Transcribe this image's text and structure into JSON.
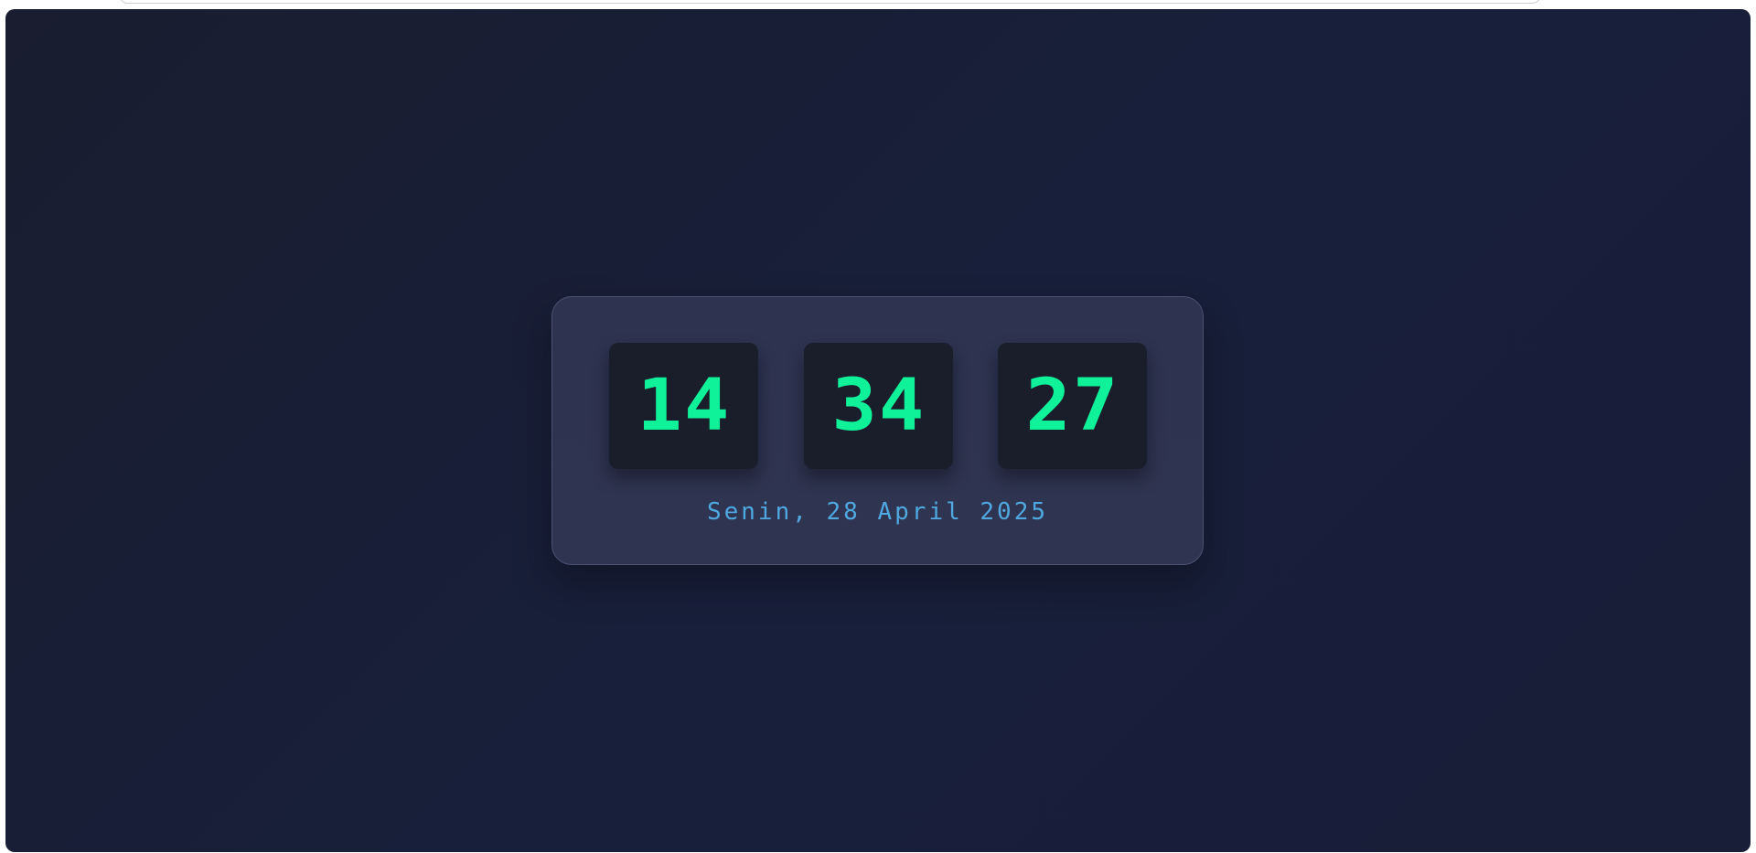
{
  "clock": {
    "hours": "14",
    "minutes": "34",
    "seconds": "27",
    "date": "Senin, 28 April 2025"
  },
  "colors": {
    "digit": "#10f29a",
    "date": "#4fa8e0",
    "card": "#2e3350",
    "digit_box": "#1a1d2a",
    "background": "#181e38"
  }
}
